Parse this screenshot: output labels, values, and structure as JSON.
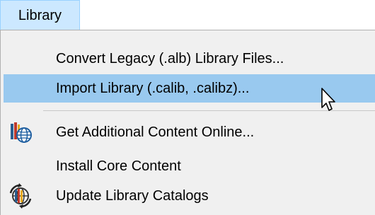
{
  "menubar": {
    "active_menu_label": "Library"
  },
  "menu": {
    "items": [
      {
        "label": "Convert Legacy (.alb) Library Files...",
        "icon": null
      },
      {
        "label": "Import Library (.calib, .calibz)...",
        "icon": null,
        "highlighted": true
      },
      {
        "label": "Get Additional Content Online...",
        "icon": "books-globe-icon"
      },
      {
        "label": "Install Core Content",
        "icon": null
      },
      {
        "label": "Update Library Catalogs",
        "icon": "globe-refresh-icon"
      }
    ]
  },
  "colors": {
    "menubar_active_bg": "#cce8ff",
    "menu_bg": "#f0f0f0",
    "highlight_bg": "#99c9ef"
  },
  "cursor": {
    "icon": "arrow-cursor-icon"
  }
}
